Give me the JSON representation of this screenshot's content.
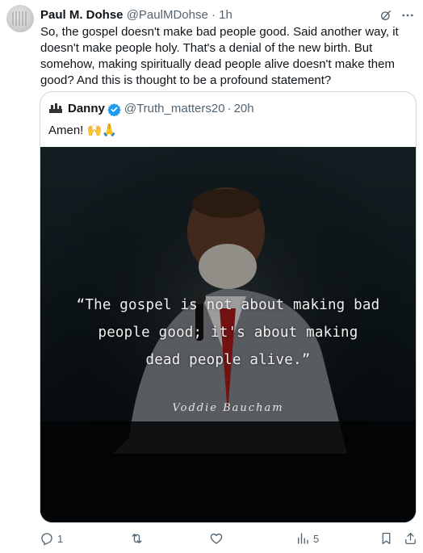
{
  "tweet": {
    "author_name": "Paul M. Dohse",
    "author_handle": "@PaulMDohse",
    "separator": "·",
    "time": "1h",
    "text": "So, the gospel doesn't make bad people good. Said another way, it doesn't make people holy. That's a denial of the new birth. But somehow, making spiritually dead people alive doesn't make them good? And this is thought to be a profound statement?"
  },
  "quoted_tweet": {
    "author_name": "Danny",
    "author_handle": "@Truth_matters20",
    "separator": "·",
    "time": "20h",
    "text": "Amen! 🙌🙏",
    "image": {
      "quote_lines": [
        "“The gospel is not about making bad",
        "people good; it's about making",
        "dead people alive.”"
      ],
      "signature": "Voddie Baucham"
    }
  },
  "actions": {
    "reply_count": "1",
    "retweet_count": "",
    "like_count": "",
    "views_count": "5"
  },
  "icons": {
    "header": [
      "grok-icon",
      "more-icon"
    ],
    "action_bar": [
      "reply-icon",
      "retweet-icon",
      "like-icon",
      "views-icon",
      "bookmark-icon",
      "share-icon"
    ]
  },
  "colors": {
    "text_primary": "#0f1419",
    "text_secondary": "#536471",
    "border": "#cfd9de",
    "verified_blue": "#1d9bf0"
  }
}
